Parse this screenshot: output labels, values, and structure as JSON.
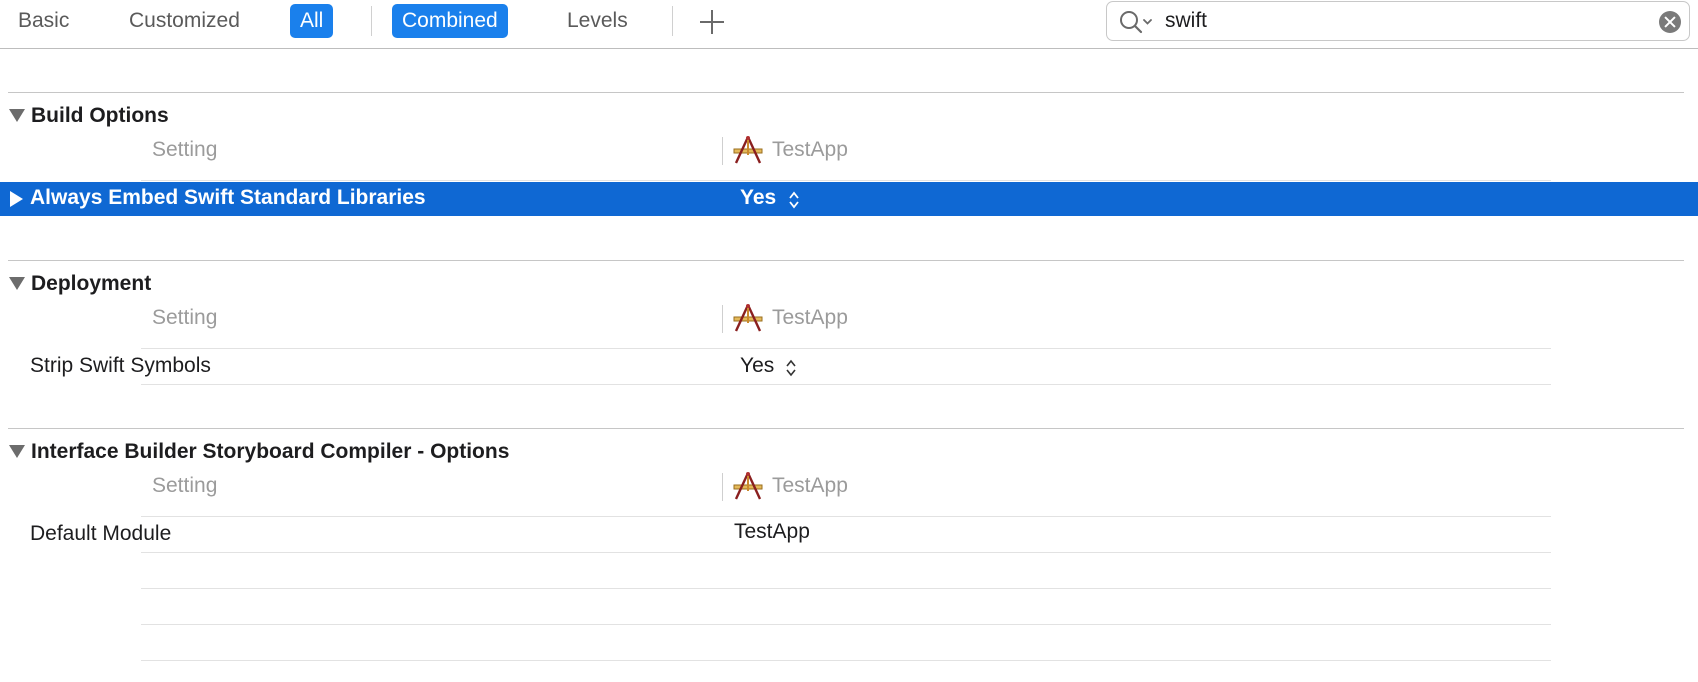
{
  "toolbar": {
    "basic": "Basic",
    "customized": "Customized",
    "all": "All",
    "combined": "Combined",
    "levels": "Levels",
    "add_icon": "plus-icon"
  },
  "search": {
    "value": "swift",
    "icon": "search-icon",
    "clear_icon": "clear-icon"
  },
  "sections": [
    {
      "title": "Build Options",
      "header_setting": "Setting",
      "header_target": "TestApp",
      "rows": [
        {
          "label": "Always Embed Swift Standard Libraries",
          "value": "Yes",
          "selected": true
        }
      ]
    },
    {
      "title": "Deployment",
      "header_setting": "Setting",
      "header_target": "TestApp",
      "rows": [
        {
          "label": "Strip Swift Symbols",
          "value": "Yes",
          "selected": false
        }
      ]
    },
    {
      "title": "Interface Builder Storyboard Compiler - Options",
      "header_setting": "Setting",
      "header_target": "TestApp",
      "rows": [
        {
          "label": "Default Module",
          "value": "TestApp",
          "selected": false
        }
      ]
    }
  ],
  "colors": {
    "accent": "#1a80ec",
    "selection": "#0f68d3"
  }
}
